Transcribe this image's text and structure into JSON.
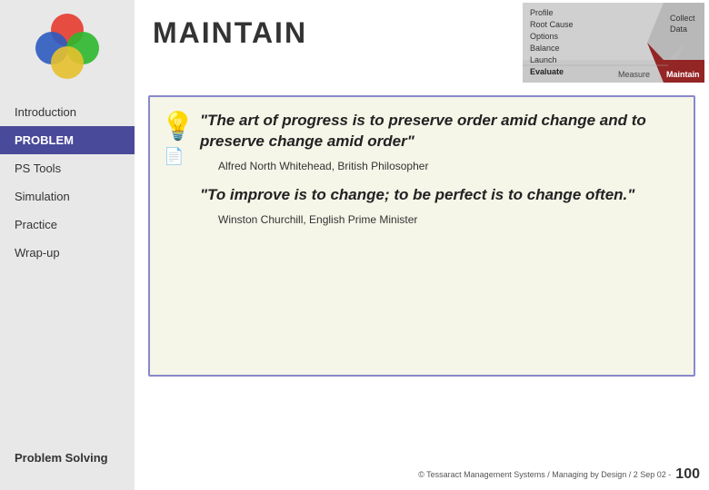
{
  "sidebar": {
    "nav_items": [
      {
        "id": "introduction",
        "label": "Introduction",
        "active": false
      },
      {
        "id": "problem",
        "label": "PROBLEM",
        "active": true
      },
      {
        "id": "ps-tools",
        "label": "PS Tools",
        "active": false
      },
      {
        "id": "simulation",
        "label": "Simulation",
        "active": false
      },
      {
        "id": "practice",
        "label": "Practice",
        "active": false
      },
      {
        "id": "wrap-up",
        "label": "Wrap-up",
        "active": false
      }
    ],
    "bottom_label": "Problem Solving"
  },
  "header": {
    "title": "MAINTAIN"
  },
  "diagram": {
    "left_items": [
      "Profile",
      "Root Cause",
      "Options",
      "Balance",
      "Launch",
      "Evaluate"
    ],
    "right_label": "Collect\nData",
    "bottom_left": "Measure",
    "bottom_right": "Maintain"
  },
  "content": {
    "quote1": "\"The art of progress is to preserve order amid change and to preserve change amid order\"",
    "attribution1": "Alfred North Whitehead, British Philosopher",
    "quote2": "\"To improve is to change; to be perfect is to change often.\"",
    "attribution2": "Winston Churchill, English Prime Minister"
  },
  "footer": {
    "copyright": "© Tessaract Management Systems / Managing by Design / 2 Sep 02  -",
    "page_number": "100"
  }
}
